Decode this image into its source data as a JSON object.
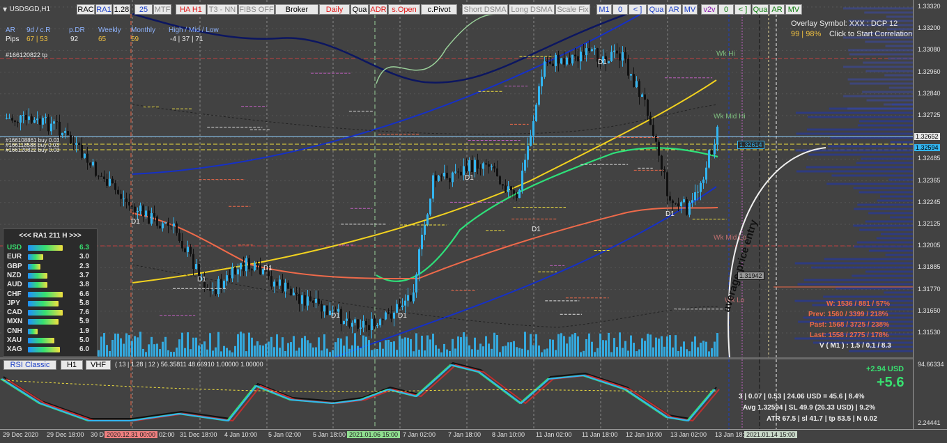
{
  "symbol_label": "USDSGD,H1",
  "toolbar": [
    {
      "label": "RAC",
      "cls": ""
    },
    {
      "label": "RA1",
      "cls": "blue"
    },
    {
      "label": "1.28",
      "cls": ""
    },
    {
      "label": "25",
      "cls": "blue"
    },
    {
      "label": "MTF",
      "cls": "gray"
    },
    {
      "label": "HA H1",
      "cls": "red"
    },
    {
      "label": "T3 - NN",
      "cls": "gray"
    },
    {
      "label": "FIBS OFF",
      "cls": "gray"
    },
    {
      "label": "Broker",
      "cls": ""
    },
    {
      "label": "Daily",
      "cls": "red"
    },
    {
      "label": "Qua",
      "cls": ""
    },
    {
      "label": "ADR",
      "cls": "red"
    },
    {
      "label": "s.Open",
      "cls": "red"
    },
    {
      "label": "c.Pivot",
      "cls": ""
    },
    {
      "label": "Short DSMA",
      "cls": "gray"
    },
    {
      "label": "Long DSMA",
      "cls": "gray"
    },
    {
      "label": "Scale Fix",
      "cls": "gray"
    },
    {
      "label": "M1",
      "cls": "blue"
    },
    {
      "label": "0",
      "cls": "blue"
    },
    {
      "label": "< ]",
      "cls": "blue"
    },
    {
      "label": "Qua",
      "cls": "blue"
    },
    {
      "label": "AR",
      "cls": "blue"
    },
    {
      "label": "MV",
      "cls": "blue"
    },
    {
      "label": "v2v",
      "cls": "purple"
    },
    {
      "label": "0",
      "cls": "green"
    },
    {
      "label": "< ]",
      "cls": "green"
    },
    {
      "label": "Qua",
      "cls": "green"
    },
    {
      "label": "AR",
      "cls": "green"
    },
    {
      "label": "MV",
      "cls": "green"
    }
  ],
  "adr_table": {
    "headers": [
      "AR",
      "9d / c.R",
      "p.DR",
      "Weekly",
      "Monthly",
      "High / Mid / Low"
    ],
    "row_label": "Pips",
    "values": [
      "67 | 53",
      "92",
      "65",
      "59",
      "-4 | 37 | 71"
    ]
  },
  "order_labels": {
    "tp": "#166120822 tp",
    "buy1": "#166108861 buy 0.03",
    "buy2": "#166118588 buy 0.03",
    "buy3": "#166120822 buy 0.03"
  },
  "overlay": {
    "line1": "Overlay Symbol: XXX : DCP 12",
    "line2_pct": "99 | 98%",
    "line2_text": "Click to Start Correlation"
  },
  "level_labels": {
    "wk_hi": "Wk Hi",
    "wk_mid_hi": "Wk Mid Hi",
    "wk_mid_lo": "Wk Mid Lo",
    "wk_lo": "Wk Lo",
    "d1": "D1"
  },
  "annotation": "average price entry",
  "strength": {
    "header": "<<<  RA1  211  H  >>>",
    "rows": [
      {
        "ccy": "USD",
        "value": "6.3",
        "highlight": true
      },
      {
        "ccy": "EUR",
        "value": "3.0"
      },
      {
        "ccy": "GBP",
        "value": "2.3"
      },
      {
        "ccy": "NZD",
        "value": "3.7"
      },
      {
        "ccy": "AUD",
        "value": "3.8"
      },
      {
        "ccy": "CHF",
        "value": "6.6 *"
      },
      {
        "ccy": "JPY",
        "value": "5.8"
      },
      {
        "ccy": "CAD",
        "value": "7.6 *"
      },
      {
        "ccy": "MXN",
        "value": "5.9"
      },
      {
        "ccy": "CNH",
        "value": "1.9"
      },
      {
        "ccy": "XAU",
        "value": "5.0"
      },
      {
        "ccy": "XAG",
        "value": "6.0"
      }
    ]
  },
  "stats": {
    "w": "W: 1536 / 881 / 57%",
    "prev": "Prev: 1560 / 3399 / 218%",
    "past": "Past: 1568 / 3725 / 238%",
    "last": "Last: 1558 / 2775 / 178%",
    "v": "V ( M1 ) : 1.5 / 0.1 / 8.3"
  },
  "pnl": {
    "usd": "+2.94 USD",
    "big": "+5.6",
    "line1": "3  |  0.07  |  0.53  |  24.06 USD = 45.6  |  8.4%",
    "line2": "Avg 1.32594  |  SL 49.9 (26.33 USD)  |  9.2%",
    "line3": "ATR 67.5  | sl 41.7  |  tp 83.5  |  N 0.02"
  },
  "rsi_panel": {
    "buttons": [
      "RSI Classic",
      "H1",
      "VHF"
    ],
    "params": "( 13 | 1.28 | 12 ) 56.35811 48.66910 1.00000 1.00000",
    "axis_top": "94.66334",
    "axis_bottom": "2.24441"
  },
  "price_boxes": {
    "current": "1.32652",
    "ask": "1.32594",
    "line_a": "1.32614",
    "line_b": "1.31942"
  },
  "y_axis": [
    "1.33320",
    "1.33200",
    "1.33080",
    "1.32960",
    "1.32840",
    "1.32725",
    "1.32605",
    "1.32485",
    "1.32365",
    "1.32245",
    "1.32125",
    "1.32005",
    "1.31885",
    "1.31770",
    "1.31650",
    "1.31530"
  ],
  "x_axis": [
    "29 Dec 2020",
    "29 Dec 18:00",
    "30 D",
    "2020.12.31 00:00",
    "02:00",
    "31 Dec 18:00",
    "4 Jan 10:00",
    "5 Jan 02:00",
    "5 Jan 18:00",
    "2021.01.06 15:00",
    "7 Jan 02:00",
    "7 Jan 18:00",
    "8 Jan 10:00",
    "11 Jan 02:00",
    "11 Jan 18:00",
    "12 Jan 10:00",
    "13 Jan 02:00",
    "13 Jan 18:",
    "2021.01.14 15:00"
  ],
  "colors": {
    "bg": "#424242",
    "candle": "#33b5f0",
    "ma_yellow": "#f2d21f",
    "ma_green": "#2ee07a",
    "ma_red": "#ef6a4a",
    "channel_blue": "#1530c8",
    "navy": "#0c1660"
  }
}
